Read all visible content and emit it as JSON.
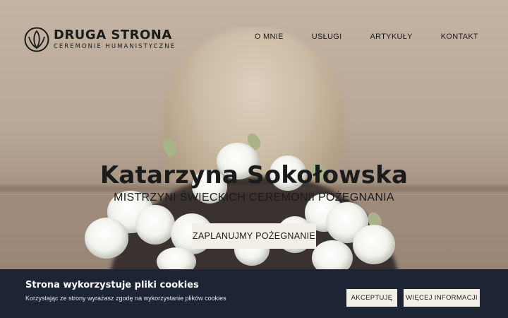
{
  "brand": {
    "title": "DRUGA STRONA",
    "subtitle": "CEREMONIE HUMANISTYCZNE",
    "logo_icon": "lotus-leaf-icon"
  },
  "nav": {
    "items": [
      {
        "label": "O MNIE"
      },
      {
        "label": "USŁUGI"
      },
      {
        "label": "ARTYKUŁY"
      },
      {
        "label": "KONTAKT"
      }
    ]
  },
  "hero": {
    "title": "Katarzyna Sokołowska",
    "subtitle": "MISTRZYNI ŚWIECKICH CEREMONII POŻEGNANIA",
    "cta_label": "ZAPLANUJMY POŻEGNANIE"
  },
  "cookie": {
    "title": "Strona wykorzystuje pliki cookies",
    "text": "Korzystając ze strony wyrażasz zgodę na wykorzystanie plików cookies",
    "accept_label": "AKCEPTUJĘ",
    "more_label": "WIĘCEJ INFORMACJI"
  },
  "colors": {
    "text_dark": "#1b1b1b",
    "button_bg": "#f3eee6",
    "cookie_bg": "#1d2433"
  }
}
